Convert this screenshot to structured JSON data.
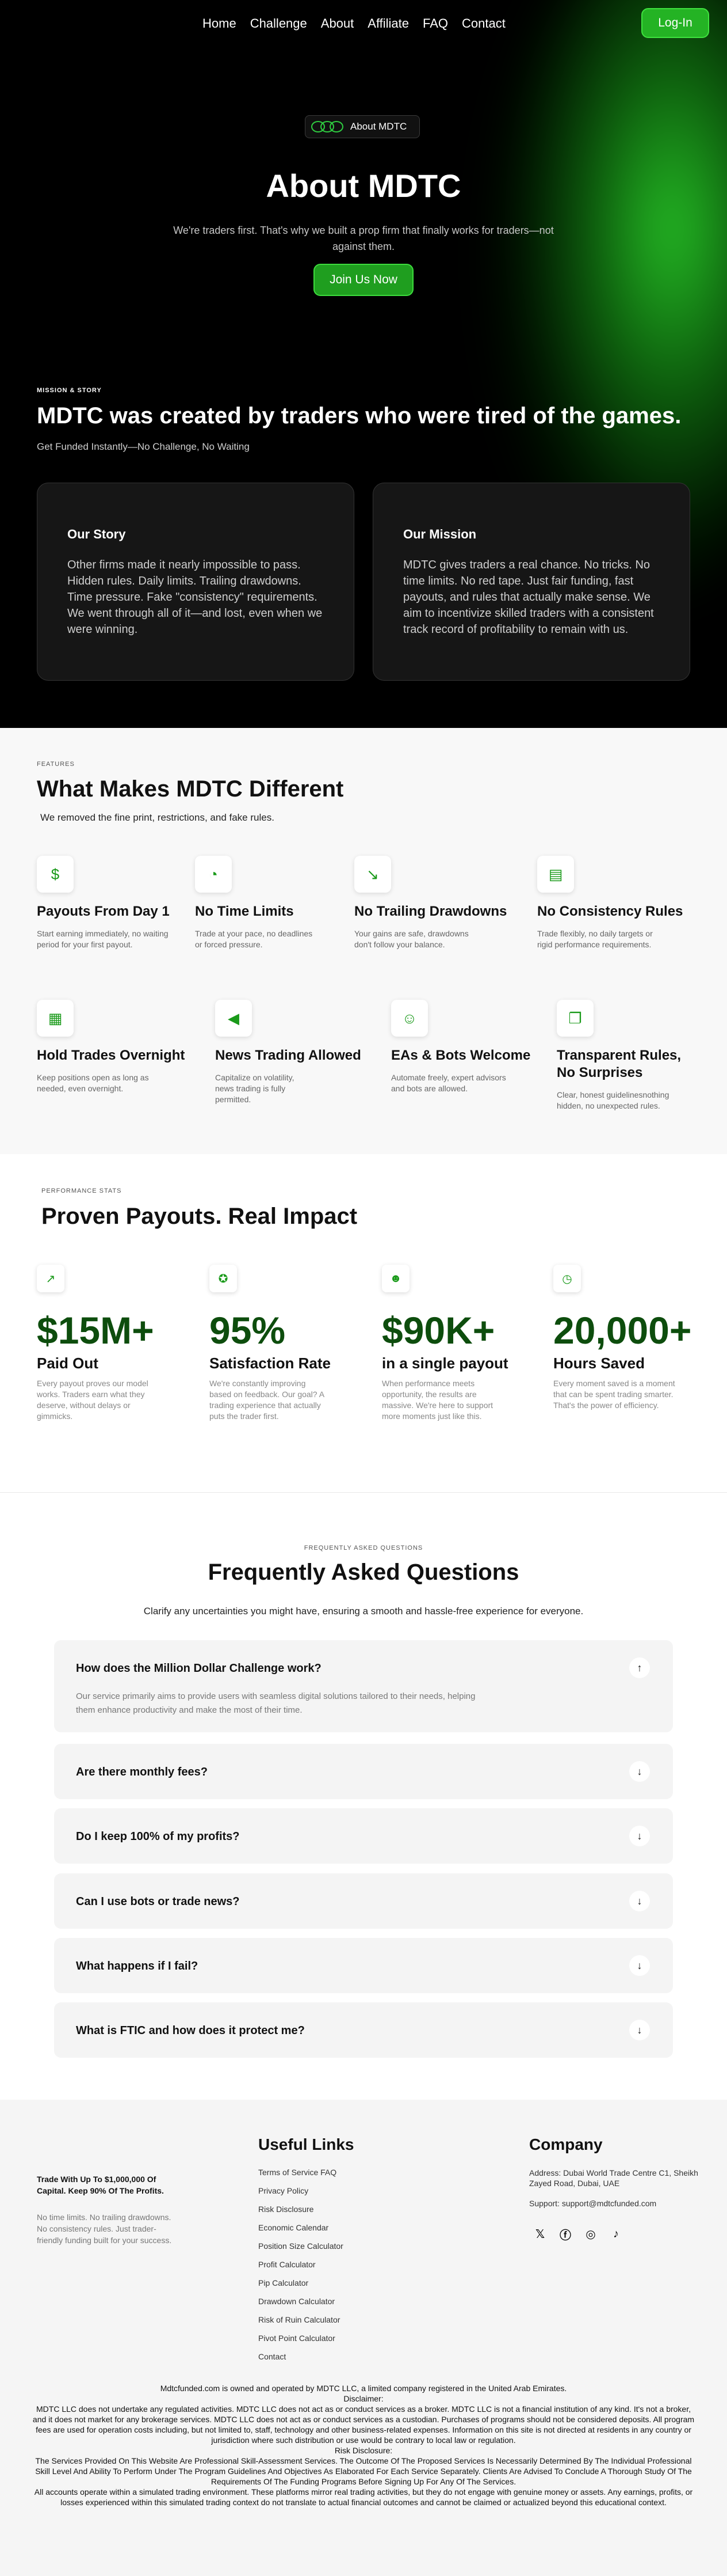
{
  "nav": {
    "links": [
      "Home",
      "Challenge",
      "About",
      "Affiliate",
      "FAQ",
      "Contact"
    ],
    "login": "Log-In"
  },
  "hero": {
    "badge": "About MDTC",
    "title": "About MDTC",
    "subtitle": "We're traders first. That's why we built a prop firm that finally works for traders—not against them.",
    "cta": "Join Us Now",
    "eyebrow": "MISSION & STORY",
    "story_title": "MDTC was created by traders who were tired of the games.",
    "story_sub": "Get Funded Instantly—No Challenge, No Waiting",
    "cards": [
      {
        "title": "Our Story",
        "body": "Other firms made it nearly impossible to pass. Hidden rules. Daily limits. Trailing drawdowns. Time pressure. Fake \"consistency\" requirements. We went through all of it—and lost, even when we were winning."
      },
      {
        "title": "Our Mission",
        "body": "MDTC gives traders a real chance. No tricks. No time limits. No red tape. Just fair funding, fast payouts, and rules that actually make sense. We aim to incentivize skilled traders with a consistent track record of profitability to remain with us."
      }
    ]
  },
  "features": {
    "eyebrow": "FEATURES",
    "title": "What Makes MDTC Different",
    "subtitle": "We removed the fine print, restrictions, and fake rules.",
    "items": [
      {
        "icon": "handshake-dollar-icon",
        "title": "Payouts From Day 1",
        "desc": "Start earning immediately, no waiting period for your first payout."
      },
      {
        "icon": "clock-check-icon",
        "title": "No Time Limits",
        "desc": "Trade at your pace, no deadlines or forced pressure."
      },
      {
        "icon": "trend-down-icon",
        "title": "No Trailing Drawdowns",
        "desc": "Your gains are safe, drawdowns don't follow your balance."
      },
      {
        "icon": "book-open-icon",
        "title": "No Consistency Rules",
        "desc": "Trade flexibly, no daily targets or rigid performance requirements."
      },
      {
        "icon": "calendar-clock-icon",
        "title": "Hold Trades Overnight",
        "desc": "Keep positions open as long as needed, even overnight."
      },
      {
        "icon": "megaphone-icon",
        "title": "News Trading Allowed",
        "desc": "Capitalize on volatility, news trading is fully permitted."
      },
      {
        "icon": "robot-icon",
        "title": "EAs & Bots Welcome",
        "desc": "Automate freely, expert advisors and bots are allowed."
      },
      {
        "icon": "documents-icon",
        "title": "Transparent Rules, No Surprises",
        "desc": "Clear, honest guidelinesnothing hidden, no unexpected rules."
      }
    ]
  },
  "stats": {
    "eyebrow": "PERFORMANCE STATS",
    "title": "Proven Payouts. Real Impact",
    "items": [
      {
        "icon": "chart-line-icon",
        "value": "$15M+",
        "label": "Paid Out",
        "desc": "Every payout proves our model works. Traders earn what they deserve, without delays or gimmicks."
      },
      {
        "icon": "star-badge-icon",
        "value": "95%",
        "label": "Satisfaction Rate",
        "desc": "We're constantly improving based on feedback. Our goal? A trading experience that actually puts the trader first."
      },
      {
        "icon": "user-plus-icon",
        "value": "$90K+",
        "label": "in a single payout",
        "desc": "When performance meets opportunity, the results are massive. We're here to support more moments just like this."
      },
      {
        "icon": "clock-icon",
        "value": "20,000+",
        "label": "Hours Saved",
        "desc": "Every moment saved is a moment that can be spent trading smarter. That's the power of efficiency."
      }
    ]
  },
  "faq": {
    "eyebrow": "FREQUENTLY ASKED QUESTIONS",
    "title": "Frequently Asked Questions",
    "subtitle": "Clarify any uncertainties you might have, ensuring a smooth and hassle-free experience for everyone.",
    "items": [
      {
        "q": "How does the Million Dollar Challenge work?",
        "a": "Our service primarily aims to provide users with seamless digital solutions tailored to their needs, helping them enhance productivity and make the most of their time.",
        "icon": "↑"
      },
      {
        "q": "Are there monthly fees?",
        "icon": "↓"
      },
      {
        "q": "Do I keep 100% of my profits?",
        "icon": "↓"
      },
      {
        "q": "Can I use bots or trade news?",
        "icon": "↓"
      },
      {
        "q": "What happens if I fail?",
        "icon": "↓"
      },
      {
        "q": "What is FTIC and how does it protect me?",
        "icon": "↓"
      }
    ]
  },
  "footer": {
    "tagline": "Trade With Up To $1,000,000 Of Capital. Keep 90% Of The Profits.",
    "desc": "No time limits. No trailing drawdowns. No consistency rules. Just trader-friendly funding built for your success.",
    "links_title": "Useful Links",
    "links": [
      "Terms of Service FAQ",
      "Privacy Policy",
      "Risk Disclosure",
      "Economic Calendar",
      "Position Size Calculator",
      "Profit Calculator",
      "Pip Calculator",
      "Drawdown Calculator",
      "Risk of Ruin Calculator",
      "Pivot Point Calculator",
      "Contact"
    ],
    "company_title": "Company",
    "address": "Address: Dubai World Trade Centre C1, Sheikh Zayed Road, Dubai, UAE",
    "support": "Support: support@mdtcfunded.com",
    "socials": [
      "x-icon",
      "facebook-icon",
      "instagram-icon",
      "tiktok-icon"
    ],
    "legal": [
      "Mdtcfunded.com is owned and operated by MDTC LLC, a limited company registered in the United Arab Emirates.",
      "Disclaimer:",
      "MDTC LLC does not undertake any regulated activities. MDTC LLC does not act as or conduct services as a broker. MDTC LLC is not a financial institution of any kind. It's not a broker, and it does not market for any brokerage services. MDTC LLC does not act as or conduct services as a custodian. Purchases of programs should not be considered deposits. All program fees are used for operation costs including, but not limited to, staff, technology and other business-related expenses. Information on this site is not directed at residents in any country or jurisdiction where such distribution or use would be contrary to local law or regulation.",
      "Risk Disclosure:",
      "The Services Provided On This Website Are Professional Skill-Assessment Services. The Outcome Of The Proposed Services Is Necessarily Determined By The Individual Professional Skill Level And Ability To Perform Under The Program Guidelines And Objectives As Elaborated For Each Service Separately. Clients Are Advised To Conclude A Thorough Study Of The Requirements Of The Funding Programs Before Signing Up For Any Of The Services.",
      "All accounts operate within a simulated trading environment. These platforms mirror real trading activities, but they do not engage with genuine money or assets. Any earnings, profits, or losses experienced within this simulated trading context do not translate to actual financial outcomes and cannot be claimed or actualized beyond this educational context."
    ]
  }
}
